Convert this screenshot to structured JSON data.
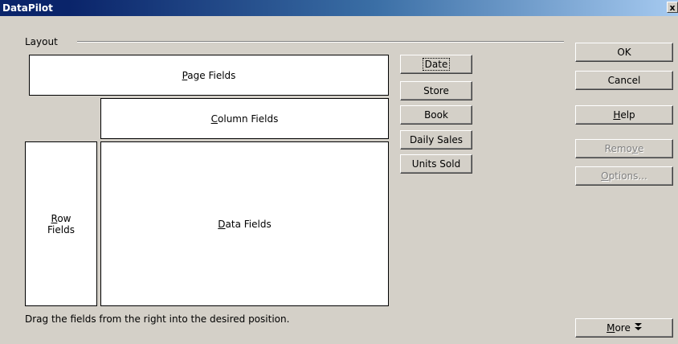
{
  "window": {
    "title": "DataPilot",
    "close_glyph": "x"
  },
  "layout": {
    "label": "Layout",
    "page_fields": {
      "accel": "P",
      "rest": "age Fields"
    },
    "column_fields": {
      "accel": "C",
      "rest": "olumn Fields"
    },
    "row_fields": {
      "accel": "R",
      "rest_line1": "ow",
      "line2": "Fields"
    },
    "data_fields": {
      "accel": "D",
      "rest": "ata Fields"
    }
  },
  "fields": [
    "Date",
    "Store",
    "Book",
    "Daily Sales",
    "Units Sold"
  ],
  "buttons": {
    "ok": "OK",
    "cancel": "Cancel",
    "help": {
      "accel": "H",
      "rest": "elp"
    },
    "remove": {
      "pre": "Remo",
      "accel": "v",
      "post": "e"
    },
    "options": {
      "accel": "O",
      "rest": "ptions..."
    },
    "more": {
      "accel": "M",
      "rest": "ore",
      "icon": "double-chevron-down-icon",
      "glyph": "⬇"
    }
  },
  "hint": "Drag the fields from the right into the desired position.",
  "colors": {
    "titlebar_start": "#0a246a",
    "titlebar_end": "#a6caf0",
    "face": "#d4d0c8"
  }
}
